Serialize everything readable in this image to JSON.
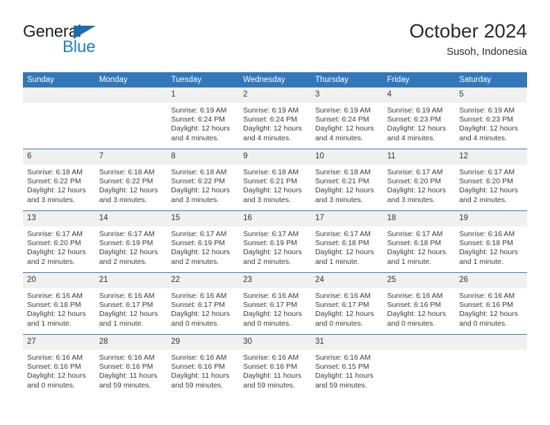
{
  "logo": {
    "word1": "General",
    "word2": "Blue",
    "triangle_color": "#1b6cb0",
    "word2_color": "#1b7fd4"
  },
  "header": {
    "title": "October 2024",
    "subtitle": "Susoh, Indonesia"
  },
  "theme": {
    "header_blue": "#3377bb",
    "daynum_band": "#f0f0f0",
    "cell_bg": "#ffffff",
    "text": "#3a3a3a"
  },
  "columns": [
    "Sunday",
    "Monday",
    "Tuesday",
    "Wednesday",
    "Thursday",
    "Friday",
    "Saturday"
  ],
  "weeks": [
    [
      {
        "day": "",
        "blank": true
      },
      {
        "day": "",
        "blank": true
      },
      {
        "day": "1",
        "sunrise": "Sunrise: 6:19 AM",
        "sunset": "Sunset: 6:24 PM",
        "daylight": "Daylight: 12 hours and 4 minutes."
      },
      {
        "day": "2",
        "sunrise": "Sunrise: 6:19 AM",
        "sunset": "Sunset: 6:24 PM",
        "daylight": "Daylight: 12 hours and 4 minutes."
      },
      {
        "day": "3",
        "sunrise": "Sunrise: 6:19 AM",
        "sunset": "Sunset: 6:24 PM",
        "daylight": "Daylight: 12 hours and 4 minutes."
      },
      {
        "day": "4",
        "sunrise": "Sunrise: 6:19 AM",
        "sunset": "Sunset: 6:23 PM",
        "daylight": "Daylight: 12 hours and 4 minutes."
      },
      {
        "day": "5",
        "sunrise": "Sunrise: 6:19 AM",
        "sunset": "Sunset: 6:23 PM",
        "daylight": "Daylight: 12 hours and 4 minutes."
      }
    ],
    [
      {
        "day": "6",
        "sunrise": "Sunrise: 6:18 AM",
        "sunset": "Sunset: 6:22 PM",
        "daylight": "Daylight: 12 hours and 3 minutes."
      },
      {
        "day": "7",
        "sunrise": "Sunrise: 6:18 AM",
        "sunset": "Sunset: 6:22 PM",
        "daylight": "Daylight: 12 hours and 3 minutes."
      },
      {
        "day": "8",
        "sunrise": "Sunrise: 6:18 AM",
        "sunset": "Sunset: 6:22 PM",
        "daylight": "Daylight: 12 hours and 3 minutes."
      },
      {
        "day": "9",
        "sunrise": "Sunrise: 6:18 AM",
        "sunset": "Sunset: 6:21 PM",
        "daylight": "Daylight: 12 hours and 3 minutes."
      },
      {
        "day": "10",
        "sunrise": "Sunrise: 6:18 AM",
        "sunset": "Sunset: 6:21 PM",
        "daylight": "Daylight: 12 hours and 3 minutes."
      },
      {
        "day": "11",
        "sunrise": "Sunrise: 6:17 AM",
        "sunset": "Sunset: 6:20 PM",
        "daylight": "Daylight: 12 hours and 3 minutes."
      },
      {
        "day": "12",
        "sunrise": "Sunrise: 6:17 AM",
        "sunset": "Sunset: 6:20 PM",
        "daylight": "Daylight: 12 hours and 2 minutes."
      }
    ],
    [
      {
        "day": "13",
        "sunrise": "Sunrise: 6:17 AM",
        "sunset": "Sunset: 6:20 PM",
        "daylight": "Daylight: 12 hours and 2 minutes."
      },
      {
        "day": "14",
        "sunrise": "Sunrise: 6:17 AM",
        "sunset": "Sunset: 6:19 PM",
        "daylight": "Daylight: 12 hours and 2 minutes."
      },
      {
        "day": "15",
        "sunrise": "Sunrise: 6:17 AM",
        "sunset": "Sunset: 6:19 PM",
        "daylight": "Daylight: 12 hours and 2 minutes."
      },
      {
        "day": "16",
        "sunrise": "Sunrise: 6:17 AM",
        "sunset": "Sunset: 6:19 PM",
        "daylight": "Daylight: 12 hours and 2 minutes."
      },
      {
        "day": "17",
        "sunrise": "Sunrise: 6:17 AM",
        "sunset": "Sunset: 6:18 PM",
        "daylight": "Daylight: 12 hours and 1 minute."
      },
      {
        "day": "18",
        "sunrise": "Sunrise: 6:17 AM",
        "sunset": "Sunset: 6:18 PM",
        "daylight": "Daylight: 12 hours and 1 minute."
      },
      {
        "day": "19",
        "sunrise": "Sunrise: 6:16 AM",
        "sunset": "Sunset: 6:18 PM",
        "daylight": "Daylight: 12 hours and 1 minute."
      }
    ],
    [
      {
        "day": "20",
        "sunrise": "Sunrise: 6:16 AM",
        "sunset": "Sunset: 6:18 PM",
        "daylight": "Daylight: 12 hours and 1 minute."
      },
      {
        "day": "21",
        "sunrise": "Sunrise: 6:16 AM",
        "sunset": "Sunset: 6:17 PM",
        "daylight": "Daylight: 12 hours and 1 minute."
      },
      {
        "day": "22",
        "sunrise": "Sunrise: 6:16 AM",
        "sunset": "Sunset: 6:17 PM",
        "daylight": "Daylight: 12 hours and 0 minutes."
      },
      {
        "day": "23",
        "sunrise": "Sunrise: 6:16 AM",
        "sunset": "Sunset: 6:17 PM",
        "daylight": "Daylight: 12 hours and 0 minutes."
      },
      {
        "day": "24",
        "sunrise": "Sunrise: 6:16 AM",
        "sunset": "Sunset: 6:17 PM",
        "daylight": "Daylight: 12 hours and 0 minutes."
      },
      {
        "day": "25",
        "sunrise": "Sunrise: 6:16 AM",
        "sunset": "Sunset: 6:16 PM",
        "daylight": "Daylight: 12 hours and 0 minutes."
      },
      {
        "day": "26",
        "sunrise": "Sunrise: 6:16 AM",
        "sunset": "Sunset: 6:16 PM",
        "daylight": "Daylight: 12 hours and 0 minutes."
      }
    ],
    [
      {
        "day": "27",
        "sunrise": "Sunrise: 6:16 AM",
        "sunset": "Sunset: 6:16 PM",
        "daylight": "Daylight: 12 hours and 0 minutes."
      },
      {
        "day": "28",
        "sunrise": "Sunrise: 6:16 AM",
        "sunset": "Sunset: 6:16 PM",
        "daylight": "Daylight: 11 hours and 59 minutes."
      },
      {
        "day": "29",
        "sunrise": "Sunrise: 6:16 AM",
        "sunset": "Sunset: 6:16 PM",
        "daylight": "Daylight: 11 hours and 59 minutes."
      },
      {
        "day": "30",
        "sunrise": "Sunrise: 6:16 AM",
        "sunset": "Sunset: 6:16 PM",
        "daylight": "Daylight: 11 hours and 59 minutes."
      },
      {
        "day": "31",
        "sunrise": "Sunrise: 6:16 AM",
        "sunset": "Sunset: 6:15 PM",
        "daylight": "Daylight: 11 hours and 59 minutes."
      },
      {
        "day": "",
        "blank": true
      },
      {
        "day": "",
        "blank": true
      }
    ]
  ]
}
